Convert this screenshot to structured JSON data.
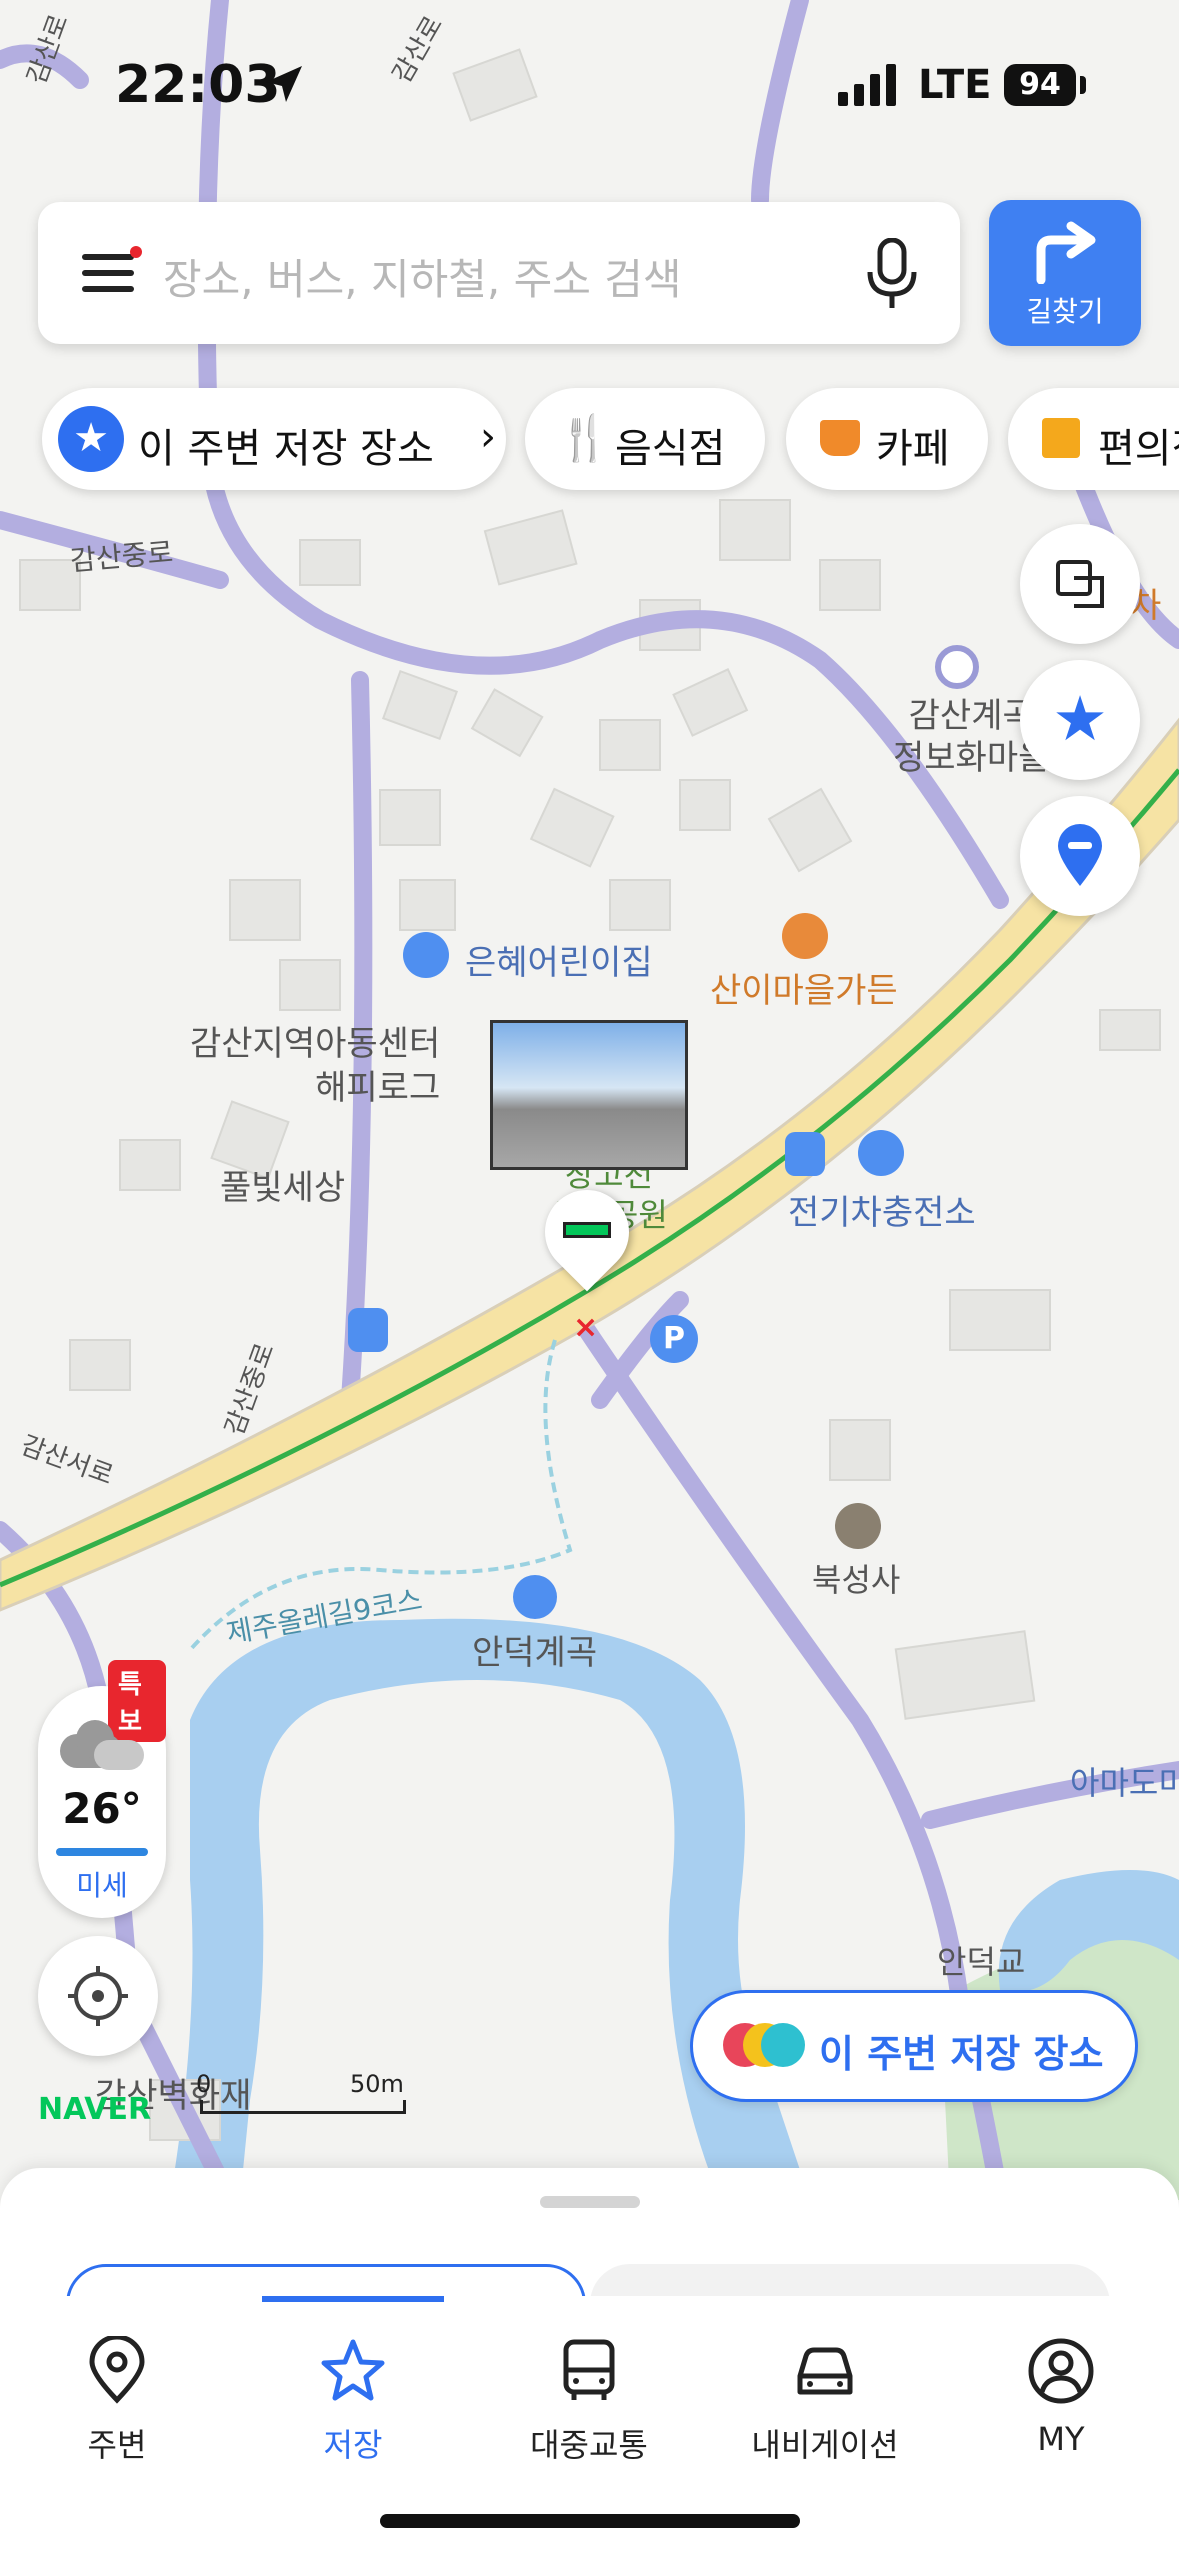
{
  "status_bar": {
    "time": "22:03",
    "network": "LTE",
    "battery": "94"
  },
  "search": {
    "placeholder": "장소, 버스, 지하철, 주소 검색",
    "route_label": "길찾기"
  },
  "categories": [
    {
      "label": "이 주변 저장 장소",
      "icon": "star-icon"
    },
    {
      "label": "음식점",
      "icon": "fork-knife-icon"
    },
    {
      "label": "카페",
      "icon": "cup-icon"
    },
    {
      "label": "편의점",
      "icon": "store-icon"
    }
  ],
  "map_labels": {
    "gamsan_jungro": "감산중로",
    "gamsan_ro_top": "감산로",
    "gamsan_ro_top2": "감산로",
    "gamsan_ro_left": "감산로",
    "gamsan_village": "감산계곡\n정보화마을",
    "daycare": "은혜어린이집",
    "garden": "산이마을가든",
    "child_center": "감산지역아동센터\n해피로그",
    "pulbit": "풀빛세상",
    "park": "창고천\n생태공원",
    "ev_charge": "전기차충전소",
    "gamsan_jungro_vertical": "감산중로",
    "gamsan_seo": "감산서로",
    "bukseongsa": "북성사",
    "olle": "제주올레길9코스",
    "andeok": "안덕계곡",
    "amado": "아마도미",
    "andeokgyo": "안덕교",
    "gamsan_byeok": "감산벽화재",
    "cha": "차"
  },
  "weather": {
    "alert": "특보",
    "temperature": "26°",
    "dust": "미세"
  },
  "scale": {
    "zero": "0",
    "distance": "50m",
    "brand": "NAVER"
  },
  "saved_places_button": "이 주변 저장 장소",
  "nav": [
    {
      "label": "주변",
      "icon": "location-pin-icon",
      "active": false
    },
    {
      "label": "저장",
      "icon": "star-icon",
      "active": true
    },
    {
      "label": "대중교통",
      "icon": "bus-icon",
      "active": false
    },
    {
      "label": "내비게이션",
      "icon": "car-icon",
      "active": false
    },
    {
      "label": "MY",
      "icon": "user-icon",
      "active": false
    }
  ],
  "colors": {
    "accent": "#2e6ff0",
    "road_main": "#f6e3a4",
    "road_minor": "#b3aee0",
    "water": "#a8cff0",
    "park": "#cfe6c8",
    "brand_green": "#03c75a",
    "poi_orange": "#e88a3a",
    "alert_red": "#e8262e"
  }
}
